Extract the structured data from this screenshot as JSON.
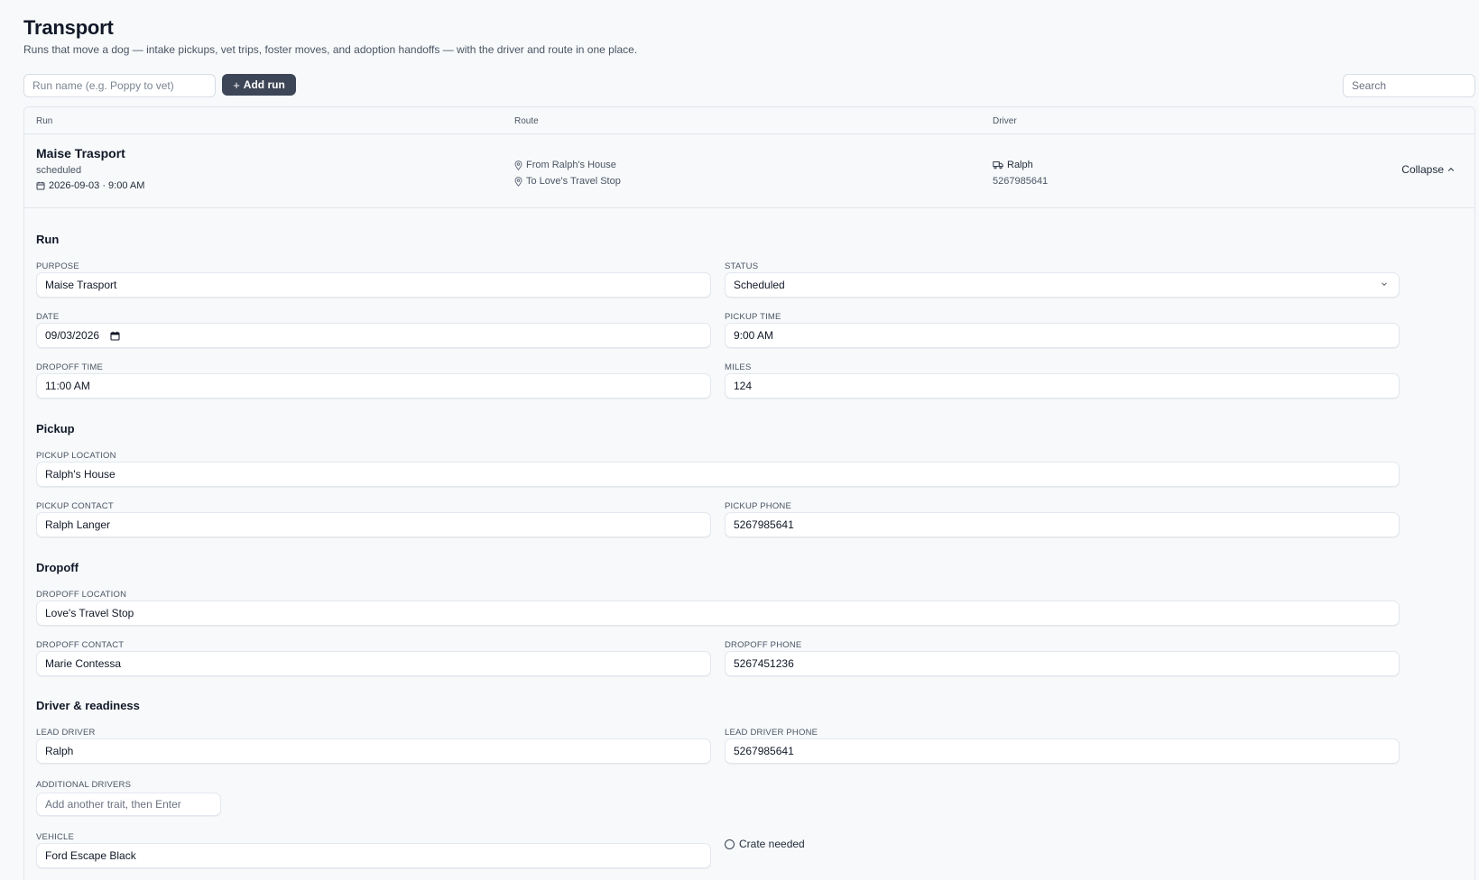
{
  "page": {
    "title": "Transport",
    "subtitle": "Runs that move a dog — intake pickups, vet trips, foster moves, and adoption handoffs — with the driver and route in one place."
  },
  "toolbar": {
    "run_name_placeholder": "Run name (e.g. Poppy to vet)",
    "add_run_label": "Add run",
    "search_placeholder": "Search"
  },
  "table": {
    "columns": [
      "Run",
      "Route",
      "Driver"
    ],
    "rows": [
      {
        "name": "Maise Trasport",
        "status": "scheduled",
        "datetime": "2026-09-03 · 9:00 AM",
        "route_from": "From Ralph's House",
        "route_to": "To Love's Travel Stop",
        "driver": "Ralph",
        "driver_phone": "5267985641",
        "toggle_label": "Collapse"
      }
    ]
  },
  "detail": {
    "sections": {
      "run": "Run",
      "pickup": "Pickup",
      "dropoff": "Dropoff",
      "driver": "Driver & readiness"
    },
    "labels": {
      "purpose": "PURPOSE",
      "status": "STATUS",
      "date": "DATE",
      "pickup_time": "PICKUP TIME",
      "dropoff_time": "DROPOFF TIME",
      "miles": "MILES",
      "pickup_location": "PICKUP LOCATION",
      "pickup_contact": "PICKUP CONTACT",
      "pickup_phone": "PICKUP PHONE",
      "dropoff_location": "DROPOFF LOCATION",
      "dropoff_contact": "DROPOFF CONTACT",
      "dropoff_phone": "DROPOFF PHONE",
      "lead_driver": "LEAD DRIVER",
      "lead_driver_phone": "LEAD DRIVER PHONE",
      "additional_drivers": "ADDITIONAL DRIVERS",
      "vehicle": "VEHICLE"
    },
    "values": {
      "purpose": "Maise Trasport",
      "status": "Scheduled",
      "date": "09/03/2026",
      "pickup_time": "9:00 AM",
      "dropoff_time": "11:00 AM",
      "miles": "124",
      "pickup_location": "Ralph's House",
      "pickup_contact": "Ralph Langer",
      "pickup_phone": "5267985641",
      "dropoff_location": "Love's Travel Stop",
      "dropoff_contact": "Marie Contessa",
      "dropoff_phone": "5267451236",
      "lead_driver": "Ralph",
      "lead_driver_phone": "5267985641",
      "vehicle": "Ford Escape Black"
    },
    "additional_drivers_placeholder": "Add another trait, then Enter",
    "crate_needed_label": "Crate needed",
    "crate_needed": false
  },
  "icons": [
    "plus-icon",
    "calendar-icon",
    "map-pin-icon",
    "truck-icon",
    "chevron-up-icon",
    "chevron-down-icon"
  ]
}
